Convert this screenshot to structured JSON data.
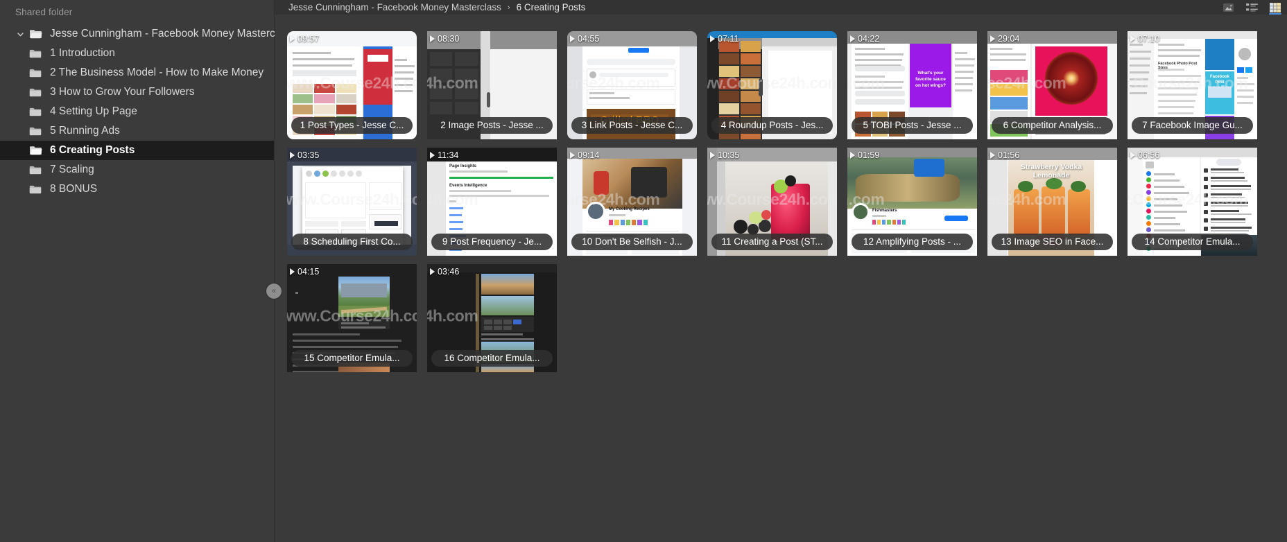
{
  "sidebar": {
    "header": "Shared folder",
    "root": {
      "label": "Jesse Cunningham - Facebook Money Masterclass",
      "expanded": true,
      "icon": "folder-open-icon"
    },
    "items": [
      {
        "label": "1 Introduction",
        "selected": false
      },
      {
        "label": "2 The Business Model - How to Make Money",
        "selected": false
      },
      {
        "label": "3 How to Grow Your Followers",
        "selected": false
      },
      {
        "label": "4 Setting Up Page",
        "selected": false
      },
      {
        "label": "5 Running Ads",
        "selected": false
      },
      {
        "label": "6 Creating Posts",
        "selected": true
      },
      {
        "label": "7 Scaling",
        "selected": false
      },
      {
        "label": "8 BONUS",
        "selected": false
      }
    ],
    "collapse_handle": "«"
  },
  "topbar": {
    "breadcrumb": [
      {
        "label": "Jesse Cunningham - Facebook Money Masterclass"
      },
      {
        "label": "6 Creating Posts"
      }
    ],
    "separator": "›",
    "views": [
      {
        "name": "photo-view-icon",
        "active": false
      },
      {
        "name": "list-view-icon",
        "active": false
      },
      {
        "name": "grid-view-icon",
        "active": true
      }
    ]
  },
  "grid": {
    "watermark": "www.Course24h.com",
    "items": [
      {
        "index": 1,
        "duration": "09:57",
        "title": "1 Post Types - Jesse C...",
        "selected": true,
        "thumb": "pinterest-board"
      },
      {
        "index": 2,
        "duration": "08:30",
        "title": "2 Image Posts - Jesse ...",
        "selected": false,
        "thumb": "dark-grid-doc"
      },
      {
        "index": 3,
        "duration": "04:55",
        "title": "3 Link Posts - Jesse C...",
        "selected": true,
        "thumb": "grilled-bbq-feed"
      },
      {
        "index": 4,
        "duration": "07:11",
        "title": "4 Roundup Posts - Jes...",
        "selected": true,
        "thumb": "food-mosaic"
      },
      {
        "index": 5,
        "duration": "04:22",
        "title": "5 TOBI Posts - Jesse ...",
        "selected": false,
        "thumb": "purple-promo"
      },
      {
        "index": 6,
        "duration": "29:04",
        "title": "6 Competitor Analysis...",
        "selected": false,
        "thumb": "blood-orange"
      },
      {
        "index": 7,
        "duration": "07:10",
        "title": "7 Facebook Image Gu...",
        "selected": false,
        "thumb": "image-size-guide"
      },
      {
        "index": 8,
        "duration": "03:35",
        "title": "8 Scheduling First Co...",
        "selected": false,
        "thumb": "scheduler-dialog"
      },
      {
        "index": 9,
        "duration": "11:34",
        "title": "9 Post Frequency - Je...",
        "selected": false,
        "thumb": "insights-report"
      },
      {
        "index": 10,
        "duration": "09:14",
        "title": "10 Don't Be Selfish - J...",
        "selected": false,
        "thumb": "cooking-page"
      },
      {
        "index": 11,
        "duration": "10:35",
        "title": "11 Creating a Post (ST...",
        "selected": false,
        "thumb": "berry-cocktail"
      },
      {
        "index": 12,
        "duration": "01:59",
        "title": "12 Amplifying Posts - ...",
        "selected": false,
        "thumb": "fishmasters"
      },
      {
        "index": 13,
        "duration": "01:56",
        "title": "13 Image SEO in Face...",
        "selected": false,
        "thumb": "strawberry-vodka"
      },
      {
        "index": 14,
        "duration": "06:56",
        "title": "14 Competitor Emula...",
        "selected": false,
        "thumb": "messenger-list"
      },
      {
        "index": 15,
        "duration": "04:15",
        "title": "15 Competitor Emula...",
        "selected": false,
        "thumb": "mountain-article"
      },
      {
        "index": 16,
        "duration": "03:46",
        "title": "16 Competitor Emula...",
        "selected": false,
        "thumb": "gallery-grid"
      }
    ]
  },
  "colors": {
    "app_bg": "#3a3a3a",
    "sidebar_bg": "#3b3b3b",
    "topbar_bg": "#333333",
    "selection_bg": "#1c1c1c",
    "accent": "#4a90e2"
  }
}
